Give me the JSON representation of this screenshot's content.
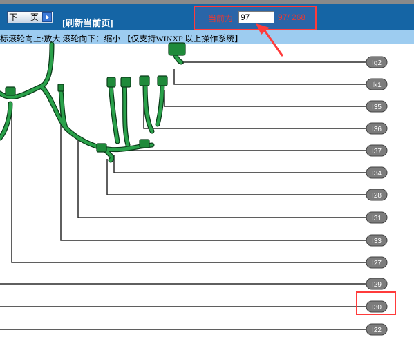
{
  "toolbar": {
    "next_page_label": "下 一 页",
    "refresh_label": "[刷新当前页]",
    "current_page_label": "当前为",
    "current_page_value": "97",
    "page_count_text": "97/ 268"
  },
  "infobar": {
    "text": "标滚轮向上:放大  滚轮向下：缩小 【仅支持WINXP 以上操作系统】"
  },
  "diagram": {
    "labels": [
      "Ig2",
      "Ik1",
      "I35",
      "I36",
      "I37",
      "I34",
      "I28",
      "I31",
      "I33",
      "I27",
      "I29",
      "I30",
      "I22"
    ]
  },
  "colors": {
    "toolbar_bg": "#1565a5",
    "infobar_bg": "#9dccf0",
    "harness_green": "#1f8a3a",
    "highlight_red": "#ff3b3b"
  }
}
